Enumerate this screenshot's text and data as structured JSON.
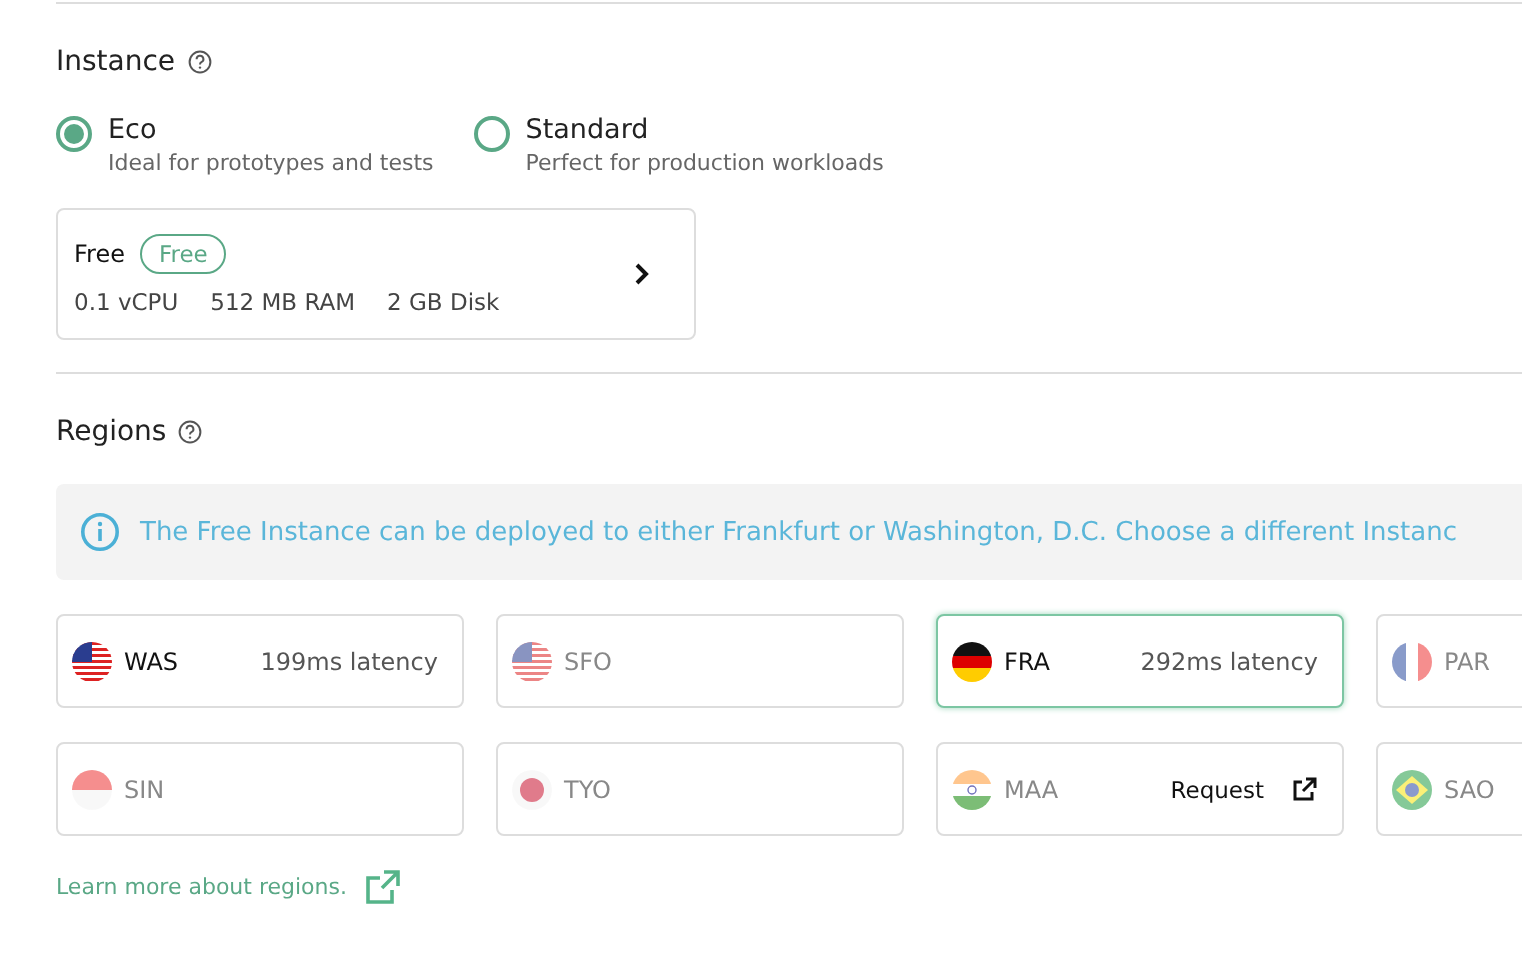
{
  "instance": {
    "title": "Instance",
    "options": [
      {
        "label": "Eco",
        "description": "Ideal for prototypes and tests",
        "selected": true
      },
      {
        "label": "Standard",
        "description": "Perfect for production workloads",
        "selected": false
      }
    ],
    "plan": {
      "name": "Free",
      "badge": "Free",
      "specs": [
        "0.1 vCPU",
        "512 MB RAM",
        "2 GB Disk"
      ]
    }
  },
  "regions": {
    "title": "Regions",
    "notice": "The Free Instance can be deployed to either Frankfurt or Washington, D.C. Choose a different Instanc",
    "items": [
      {
        "code": "WAS",
        "kind": "us",
        "latency": "199ms latency",
        "selected": false,
        "disabled": false
      },
      {
        "code": "SFO",
        "kind": "us",
        "selected": false,
        "disabled": true
      },
      {
        "code": "FRA",
        "kind": "de",
        "latency": "292ms latency",
        "selected": true,
        "disabled": false
      },
      {
        "code": "PAR",
        "kind": "fr",
        "selected": false,
        "disabled": true
      },
      {
        "code": "SIN",
        "kind": "sg",
        "selected": false,
        "disabled": true
      },
      {
        "code": "TYO",
        "kind": "jp",
        "selected": false,
        "disabled": true
      },
      {
        "code": "MAA",
        "kind": "in",
        "action": "Request",
        "selected": false,
        "disabled": true
      },
      {
        "code": "SAO",
        "kind": "br",
        "selected": false,
        "disabled": true
      }
    ],
    "link": "Learn more about regions."
  }
}
